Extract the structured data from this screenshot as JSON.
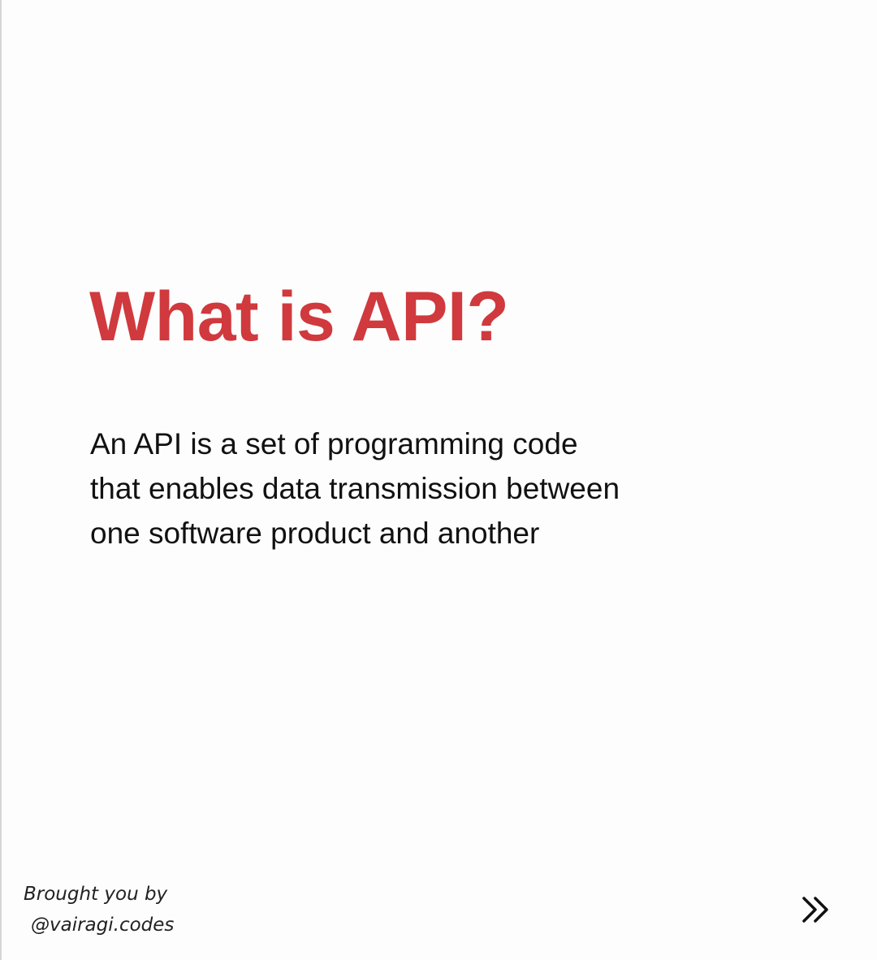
{
  "slide": {
    "title": "What is API?",
    "body_lines": [
      "An API is a set of programming code",
      "that enables data transmission between",
      "one software product and another"
    ]
  },
  "footer": {
    "credit_line_1": "Brought you by",
    "credit_line_2": "@vairagi.codes",
    "next_icon": "double-chevron-right-icon"
  },
  "colors": {
    "title": "#d0393d",
    "text": "#111111",
    "background": "#fdfdfd"
  }
}
